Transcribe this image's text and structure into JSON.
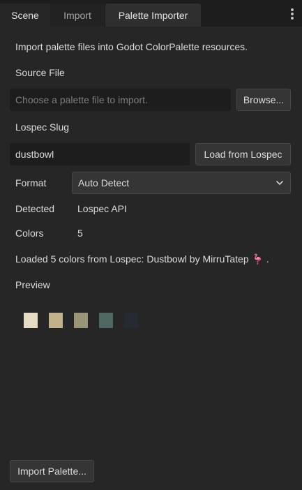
{
  "tabs": [
    {
      "label": "Scene"
    },
    {
      "label": "Import"
    },
    {
      "label": "Palette Importer"
    }
  ],
  "description": "Import palette files into Godot ColorPalette resources.",
  "source_file": {
    "label": "Source File",
    "placeholder": "Choose a palette file to import.",
    "browse_label": "Browse..."
  },
  "lospec": {
    "label": "Lospec Slug",
    "value": "dustbowl",
    "load_label": "Load from Lospec"
  },
  "format": {
    "label": "Format",
    "selected": "Auto Detect"
  },
  "detected": {
    "label": "Detected",
    "value": "Lospec API"
  },
  "colors": {
    "label": "Colors",
    "value": "5"
  },
  "status": "Loaded 5 colors from Lospec: Dustbowl by MirruTatep 🦩 .",
  "preview": {
    "label": "Preview",
    "swatches": [
      "#e6dcc4",
      "#c2b18a",
      "#9a9478",
      "#4f6762",
      "#262b33"
    ]
  },
  "import_label": "Import Palette..."
}
